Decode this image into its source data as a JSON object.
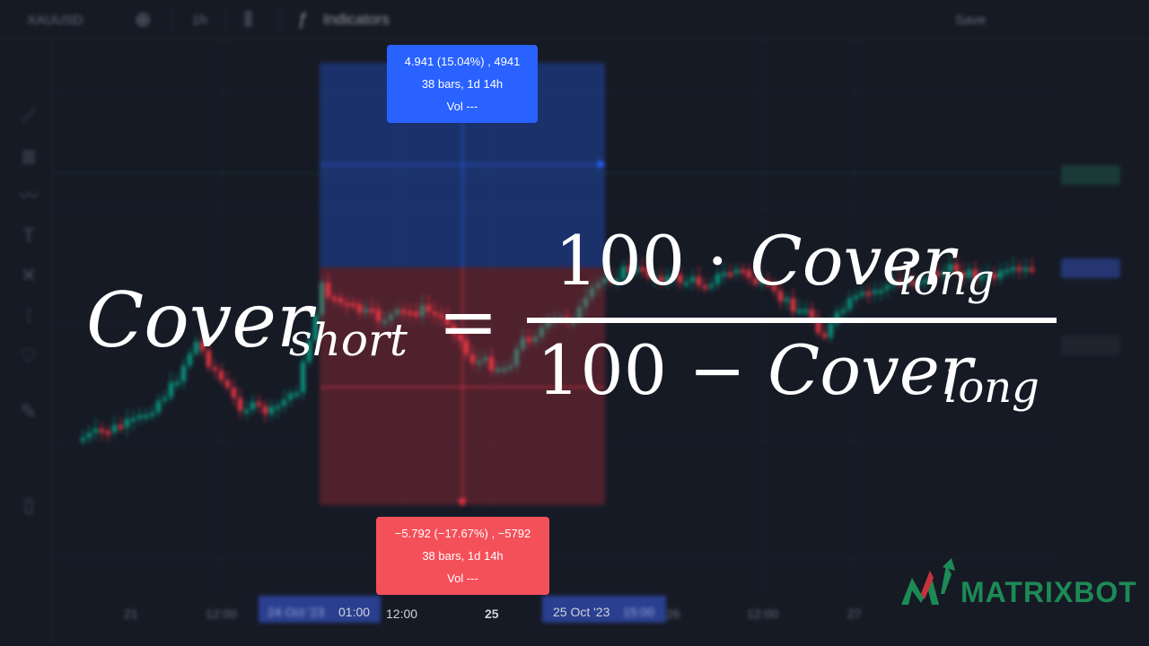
{
  "toolbar": {
    "symbol": "XAUUSD",
    "interval": "1h",
    "indicators_label": "Indicators",
    "right_label": "Save"
  },
  "measure_up": {
    "line1": "4.941 (15.04%) , 4941",
    "line2": "38 bars, 1d 14h",
    "line3": "Vol ---"
  },
  "measure_down": {
    "line1": "−5.792 (−17.67%) , −5792",
    "line2": "38 bars, 1d 14h",
    "line3": "Vol ---"
  },
  "time_axis": {
    "labels": [
      "12:00",
      "12:00",
      "25",
      "12:00",
      "27"
    ],
    "range_start": "24 Oct '23",
    "range_start_time": "01:00",
    "range_end": "25 Oct '23",
    "range_end_time": "15:00"
  },
  "formula": {
    "lhs": "Cover",
    "lhs_sub": "short",
    "equals": "=",
    "num_prefix": "100 · ",
    "num_var": "Cover",
    "num_sub": "long",
    "den_prefix": "100 − ",
    "den_var": "Cover",
    "den_sub": "long"
  },
  "logo": {
    "text": "MATRIXBOT"
  },
  "colors": {
    "background": "#161a25",
    "up_candle": "#089981",
    "down_candle": "#f23645",
    "measure_blue": "#2962ff",
    "measure_red": "#f4505a",
    "brand_green": "#1d8a55"
  }
}
